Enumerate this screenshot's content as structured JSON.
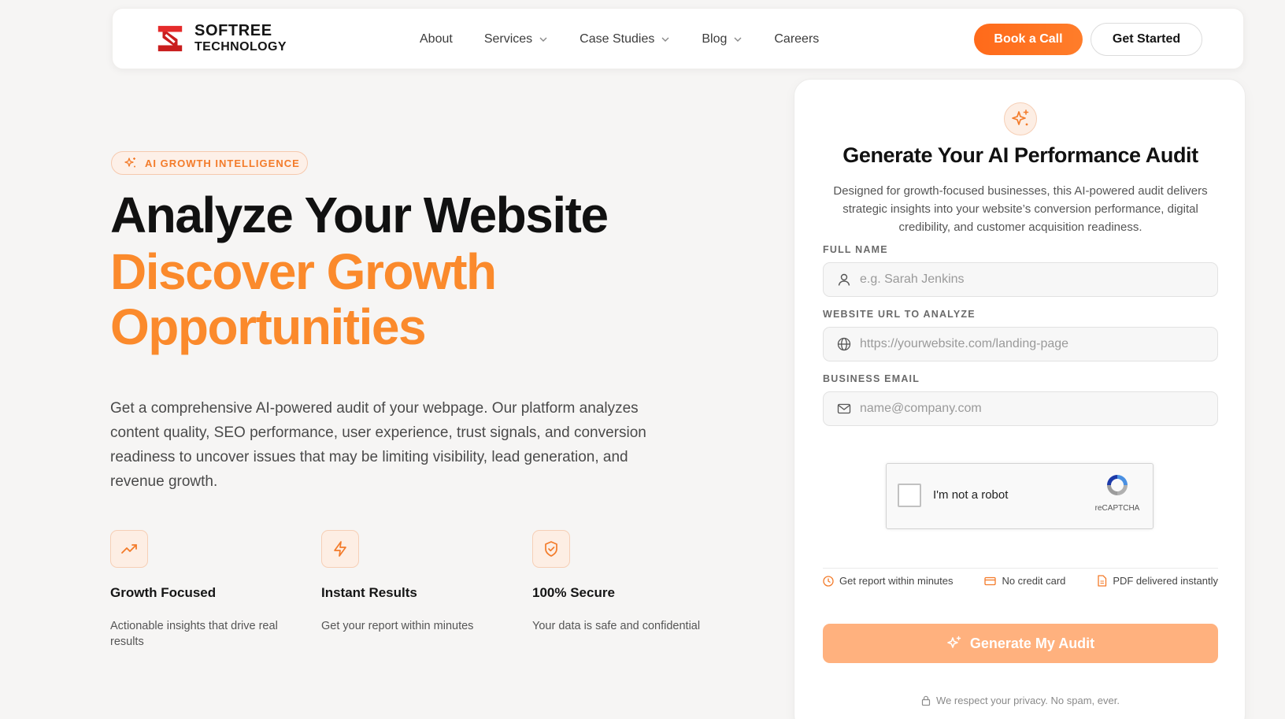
{
  "brand": {
    "name_line1": "SOFTREE",
    "name_line2": "TECHNOLOGY"
  },
  "nav": {
    "items": [
      {
        "label": "About",
        "has_dropdown": false
      },
      {
        "label": "Services",
        "has_dropdown": true
      },
      {
        "label": "Case Studies",
        "has_dropdown": true
      },
      {
        "label": "Blog",
        "has_dropdown": true
      },
      {
        "label": "Careers",
        "has_dropdown": false
      }
    ],
    "book_call_label": "Book a Call",
    "get_started_label": "Get Started"
  },
  "hero": {
    "badge": "AI GROWTH INTELLIGENCE",
    "heading_line1": "Analyze Your Website",
    "heading_line2": "Discover Growth",
    "heading_line3": "Opportunities",
    "description": "Get a comprehensive AI-powered audit of your webpage. Our platform analyzes content quality, SEO performance, user experience, trust signals, and conversion readiness to uncover issues that may be limiting visibility, lead generation, and revenue growth."
  },
  "features": [
    {
      "icon": "trending-up-icon",
      "title": "Growth Focused",
      "desc": "Actionable insights that drive real results"
    },
    {
      "icon": "lightning-icon",
      "title": "Instant Results",
      "desc": "Get your report within minutes"
    },
    {
      "icon": "shield-check-icon",
      "title": "100% Secure",
      "desc": "Your data is safe and confidential"
    }
  ],
  "audit_form": {
    "title": "Generate Your AI Performance Audit",
    "subtitle": "Designed for growth-focused businesses, this AI-powered audit delivers strategic insights into your website’s conversion performance, digital credibility, and customer acquisition readiness.",
    "full_name_label": "FULL NAME",
    "full_name_placeholder": "e.g. Sarah Jenkins",
    "url_label": "WEBSITE URL TO ANALYZE",
    "url_placeholder": "https://yourwebsite.com/landing-page",
    "email_label": "BUSINESS EMAIL",
    "email_placeholder": "name@company.com",
    "captcha_text": "I'm not a robot",
    "captcha_brand": "reCAPTCHA",
    "perks": [
      "Get report within minutes",
      "No credit card",
      "PDF delivered instantly"
    ],
    "submit_label": "Generate My Audit",
    "privacy_note": "We respect your privacy. No spam, ever."
  },
  "colors": {
    "accent": "#ff6a1a",
    "heading_orange": "#fb8a2c",
    "button_disabled": "#ffb17e",
    "background": "#f6f5f4"
  }
}
